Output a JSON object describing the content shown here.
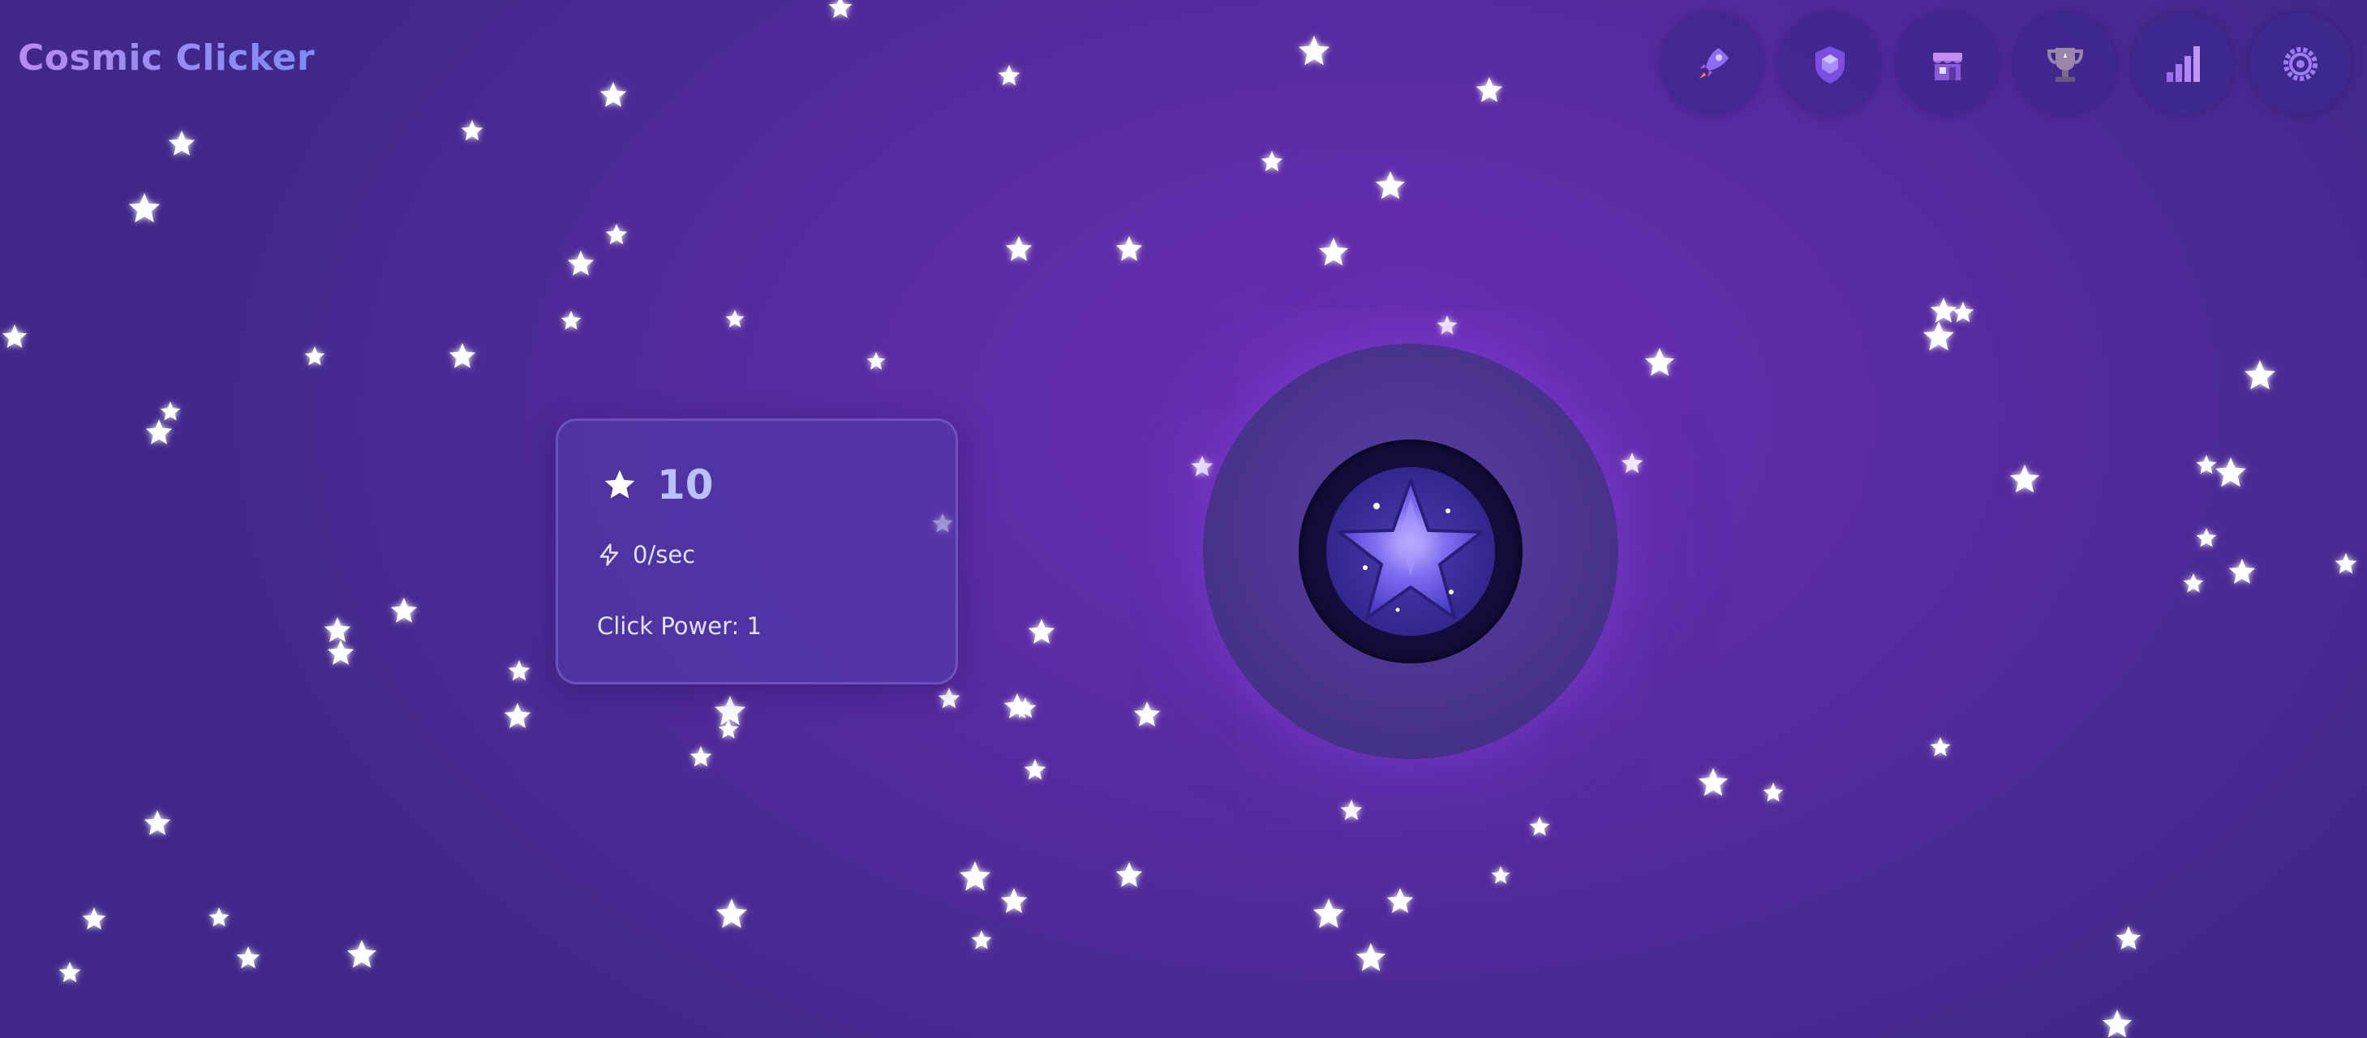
{
  "app": {
    "title": "Cosmic Clicker"
  },
  "toolbar": {
    "buttons": [
      {
        "name": "rocket-button",
        "icon": "rocket-icon"
      },
      {
        "name": "shield-button",
        "icon": "shield-gem-icon"
      },
      {
        "name": "shop-button",
        "icon": "shop-icon"
      },
      {
        "name": "achievements-button",
        "icon": "trophy-icon"
      },
      {
        "name": "stats-button",
        "icon": "bar-chart-icon"
      },
      {
        "name": "settings-button",
        "icon": "gear-icon"
      }
    ]
  },
  "stats": {
    "stars_count": "10",
    "per_second": "0/sec",
    "click_power": "Click Power: 1",
    "stars_icon": "star-icon",
    "rate_icon": "lightning-icon"
  },
  "clicker": {
    "icon": "cosmic-star-icon"
  },
  "colors": {
    "background": "#5a2ba4",
    "title_gradient_start": "#b58cf0",
    "title_gradient_end": "#7d8cf2",
    "stars_value": "#b9c2ff",
    "card_bg": "#5a3caa"
  }
}
